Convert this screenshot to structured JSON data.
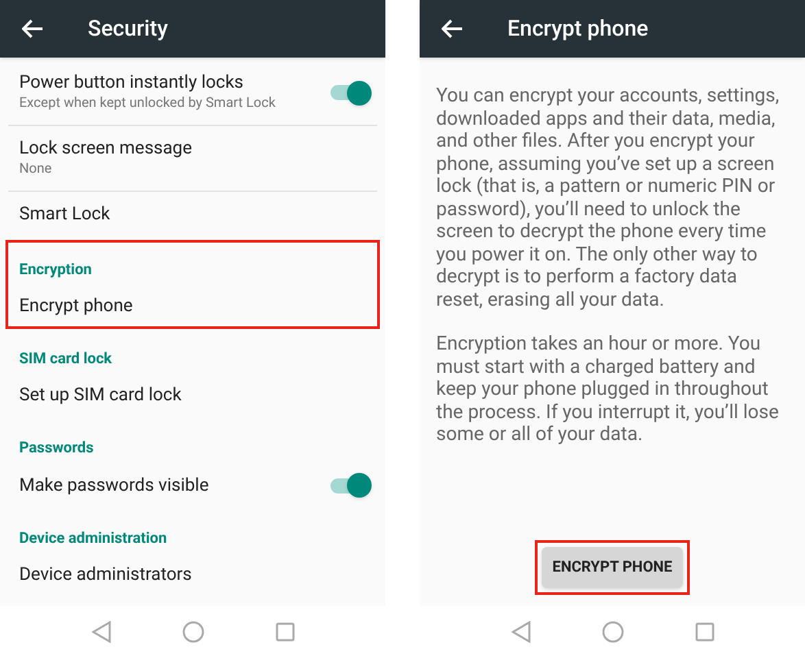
{
  "settings_screen": {
    "title": "Security",
    "sections": [
      {
        "items": [
          {
            "title": "Power button instantly locks",
            "subtitle": "Except when kept unlocked by Smart Lock",
            "toggle_on": true
          },
          {
            "title": "Lock screen message",
            "subtitle": "None"
          },
          {
            "title": "Smart Lock"
          }
        ]
      },
      {
        "header": "Encryption",
        "highlighted": true,
        "items": [
          {
            "title": "Encrypt phone"
          }
        ]
      },
      {
        "header": "SIM card lock",
        "highlighted": false,
        "items": [
          {
            "title": "Set up SIM card lock"
          }
        ]
      },
      {
        "header": "Passwords",
        "highlighted": false,
        "items": [
          {
            "title": "Make passwords visible",
            "toggle_on": true
          }
        ]
      },
      {
        "header": "Device administration",
        "highlighted": false,
        "items": [
          {
            "title": "Device administrators"
          }
        ]
      }
    ]
  },
  "encrypt_screen": {
    "title": "Encrypt phone",
    "paragraphs": [
      "You can encrypt your accounts, settings, downloaded apps and their data, media, and other files. After you encrypt your phone, assuming you’ve set up a screen lock (that is, a pattern or numeric PIN or password), you’ll need to unlock the screen to decrypt the phone every time you power it on. The only other way to decrypt is to perform a factory data reset, erasing all your data.",
      "Encryption takes an hour or more. You must start with a charged battery and keep your phone plugged in throughout the process. If you interrupt it, you’ll lose some or all of your data."
    ],
    "button": {
      "label": "ENCRYPT PHONE",
      "highlighted": true
    }
  }
}
